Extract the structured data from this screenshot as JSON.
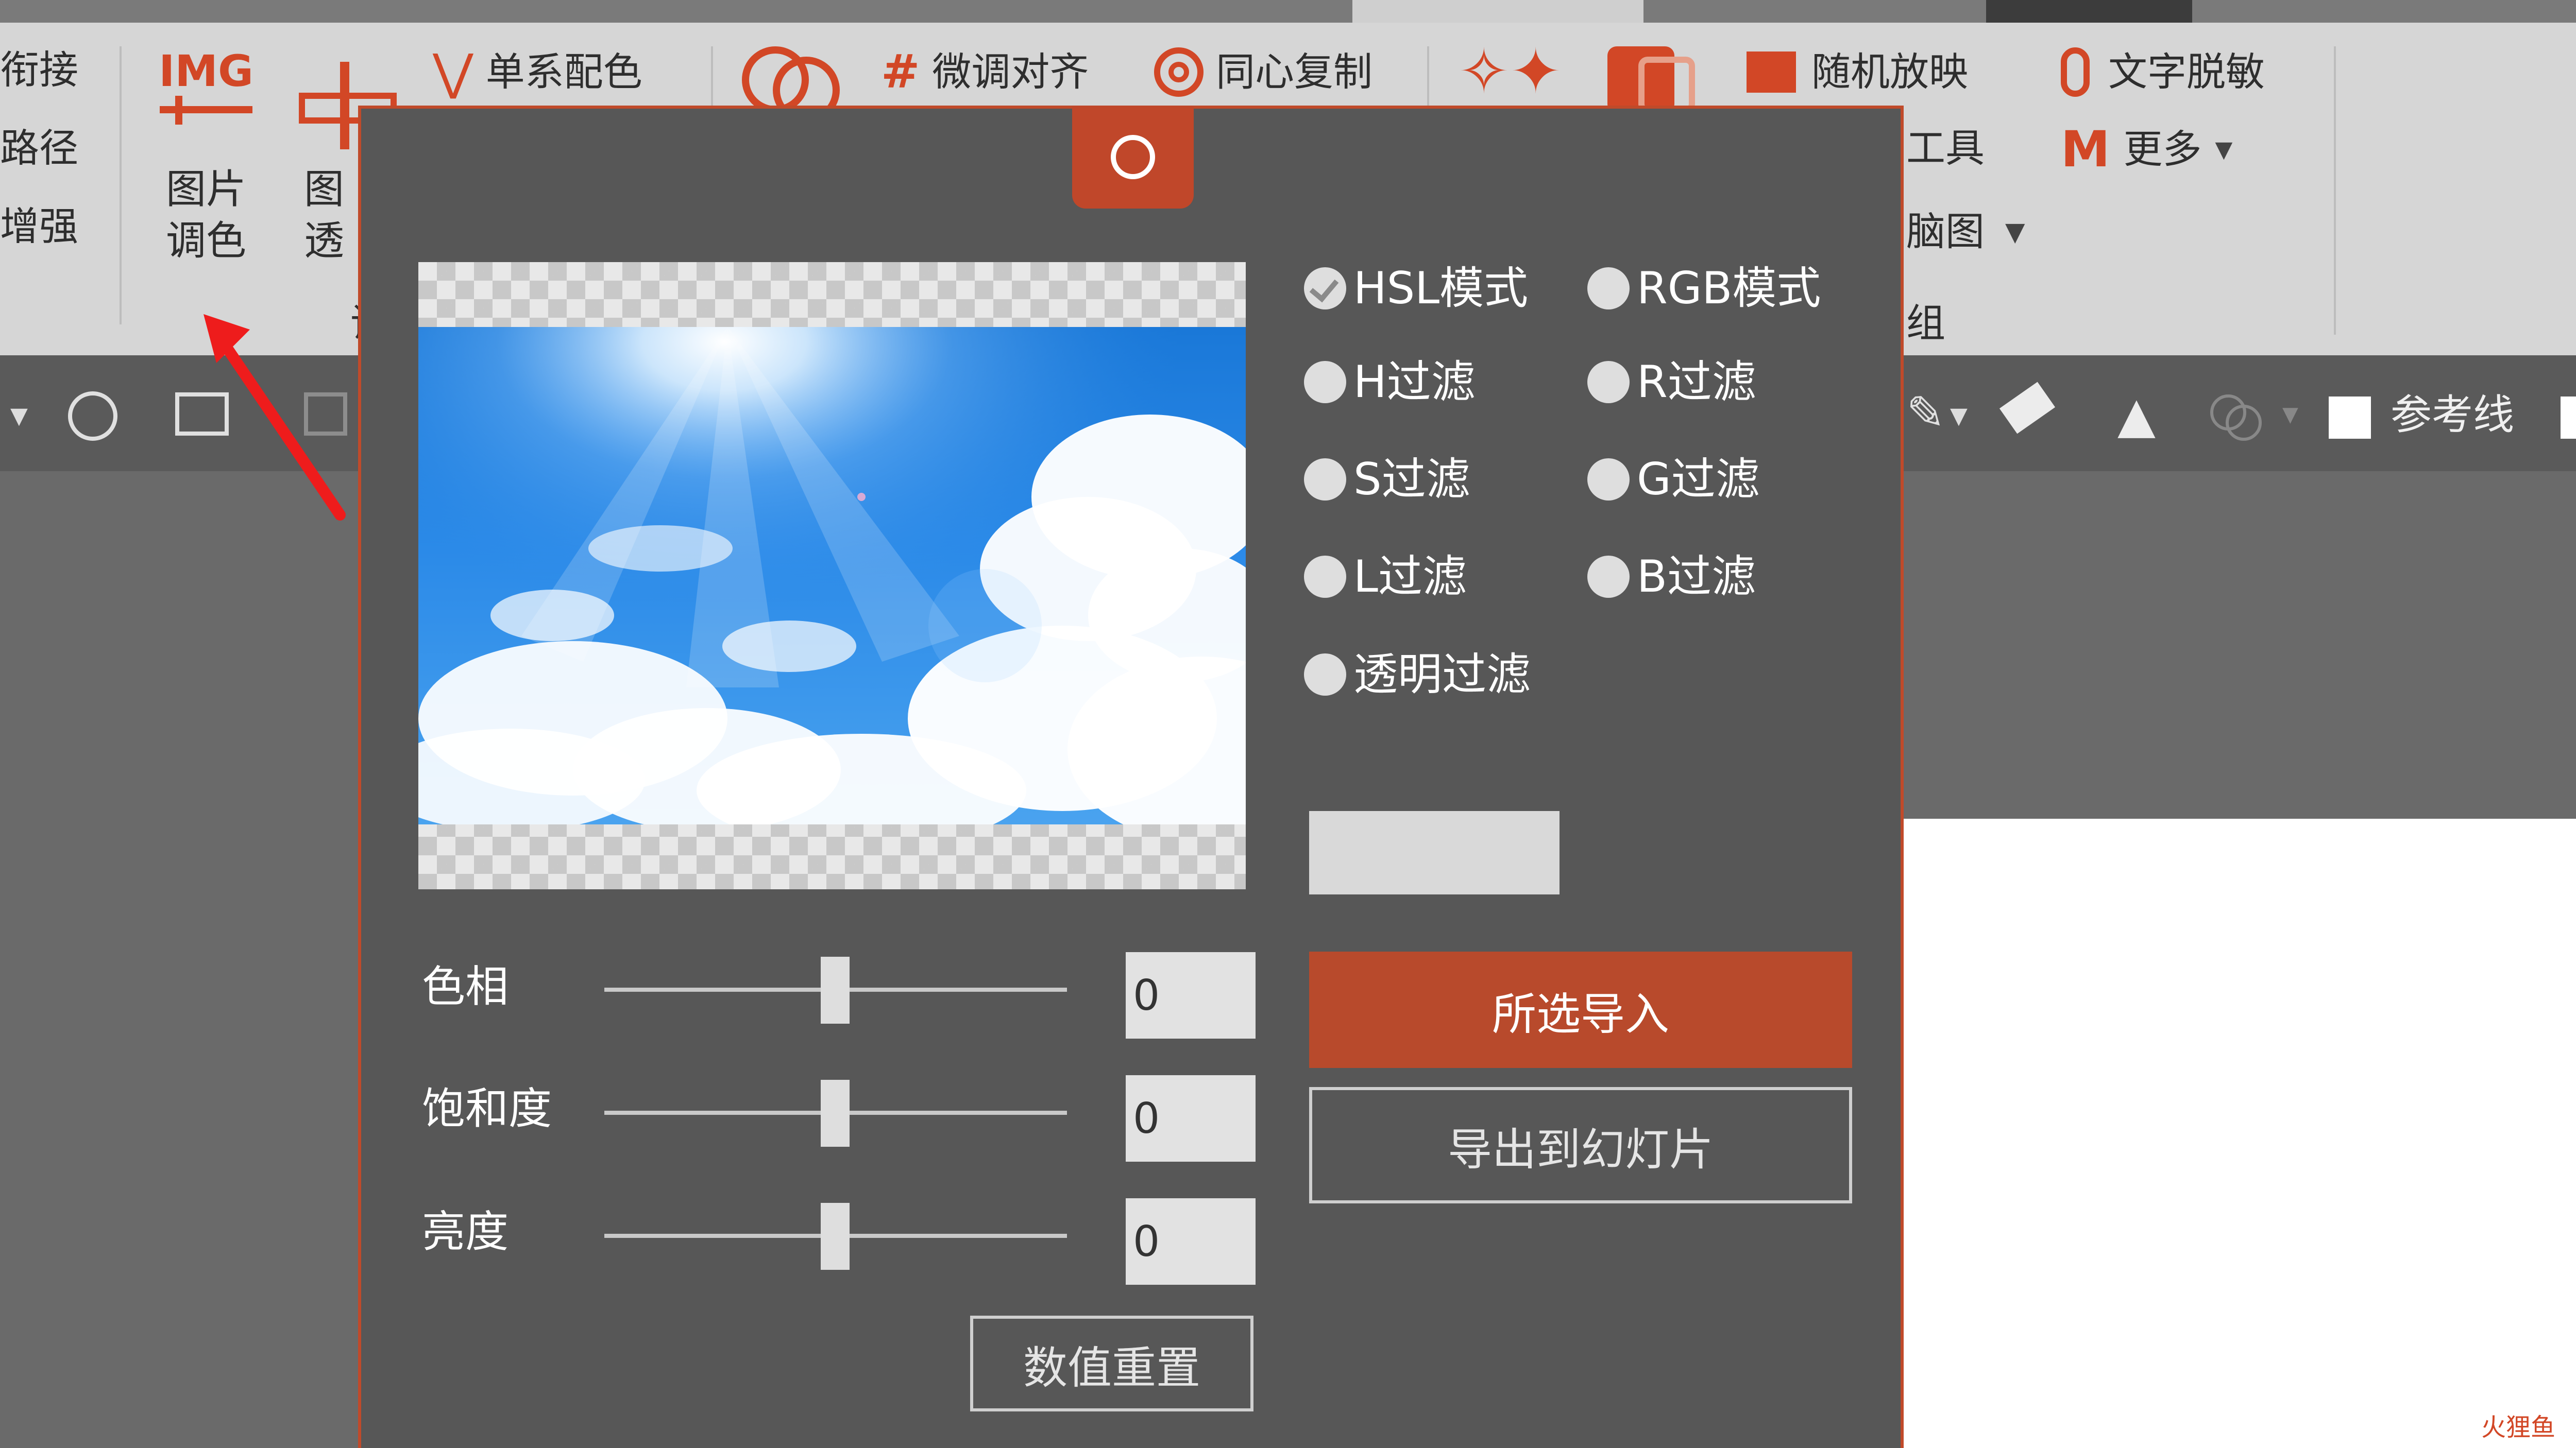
{
  "ribbon": {
    "left_partial": [
      "衔接",
      "路径",
      "增强"
    ],
    "img_icon_text": "IMG",
    "picture_color_btn": [
      "图片",
      "调色"
    ],
    "picture_transparency_btn": [
      "图",
      "透"
    ],
    "mono_color": "单系配色",
    "fine_align": "微调对齐",
    "concentric_copy": "同心复制",
    "random_show": "随机放映",
    "tools_partial": "工具",
    "mindmap_partial": "脑图",
    "group_partial": "组",
    "text_desensitize": "文字脱敏",
    "more": "更多",
    "group_label_partial": "调"
  },
  "subtoolbar": {
    "guide_lines": "参考线"
  },
  "dialog": {
    "modes": {
      "hsl": "HSL模式",
      "rgb": "RGB模式"
    },
    "filters": {
      "h": "H过滤",
      "r": "R过滤",
      "s": "S过滤",
      "g": "G过滤",
      "l": "L过滤",
      "b": "B过滤",
      "alpha": "透明过滤"
    },
    "selected_mode": "HSL模式",
    "sliders": [
      {
        "label": "色相",
        "value": "0",
        "position": 0.5
      },
      {
        "label": "饱和度",
        "value": "0",
        "position": 0.5
      },
      {
        "label": "亮度",
        "value": "0",
        "position": 0.5
      }
    ],
    "import_selected": "所选导入",
    "export_to_slide": "导出到幻灯片",
    "reset_values": "数值重置"
  },
  "watermark": "火狸鱼",
  "colors": {
    "accent": "#c0472a",
    "dialog_bg": "#575757",
    "ribbon_bg": "#d6d6d6",
    "sky": "#2b8ae8"
  },
  "icons": [
    "img-icon",
    "picture-transparency-icon",
    "chevron-down-icon",
    "circle-overlap-icon",
    "hash-align-icon",
    "concentric-icon",
    "star-icon",
    "shape-icon",
    "slideshow-icon",
    "microphone-icon",
    "m-logo-icon",
    "circle-tool-icon",
    "textbox-icon",
    "crop-icon",
    "brush-icon",
    "eraser-icon",
    "filter-icon",
    "merge-icon",
    "checkbox-icon",
    "red-arrow-annotation"
  ]
}
